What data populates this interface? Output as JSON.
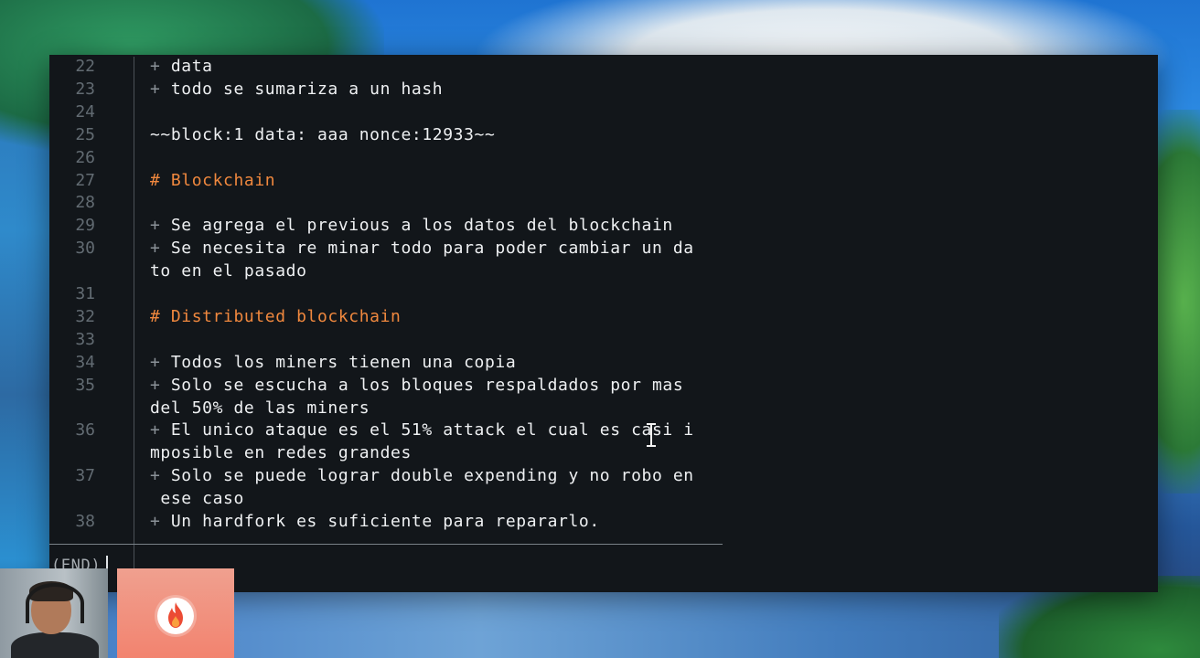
{
  "terminal": {
    "lines": [
      {
        "num": "22",
        "prefix": "+",
        "text": "data"
      },
      {
        "num": "23",
        "prefix": "+",
        "text": "todo se sumariza a un hash"
      },
      {
        "num": "24",
        "prefix": "",
        "text": ""
      },
      {
        "num": "25",
        "prefix": "",
        "text": "~~block:1 data: aaa nonce:12933~~"
      },
      {
        "num": "26",
        "prefix": "",
        "text": ""
      },
      {
        "num": "27",
        "prefix": "",
        "text": "# Blockchain"
      },
      {
        "num": "28",
        "prefix": "",
        "text": ""
      },
      {
        "num": "29",
        "prefix": "+",
        "text": "Se agrega el previous a los datos del blockchain"
      },
      {
        "num": "30",
        "prefix": "+",
        "text": "Se necesita re minar todo para poder cambiar un da"
      },
      {
        "num": "",
        "prefix": "",
        "text": "to en el pasado"
      },
      {
        "num": "31",
        "prefix": "",
        "text": ""
      },
      {
        "num": "32",
        "prefix": "",
        "text": "# Distributed blockchain"
      },
      {
        "num": "33",
        "prefix": "",
        "text": ""
      },
      {
        "num": "34",
        "prefix": "+",
        "text": "Todos los miners tienen una copia"
      },
      {
        "num": "35",
        "prefix": "+",
        "text": "Solo se escucha a los bloques respaldados por mas"
      },
      {
        "num": "",
        "prefix": "",
        "text": "del 50% de las miners"
      },
      {
        "num": "36",
        "prefix": "+",
        "text": "El unico ataque es el 51% attack el cual es casi i"
      },
      {
        "num": "",
        "prefix": "",
        "text": "mposible en redes grandes"
      },
      {
        "num": "37",
        "prefix": "+",
        "text": "Solo se puede lograr double expending y no robo en"
      },
      {
        "num": "",
        "prefix": "",
        "text": " ese caso"
      },
      {
        "num": "38",
        "prefix": "+",
        "text": "Un hardfork es suficiente para repararlo."
      }
    ],
    "end_marker": "(END)"
  },
  "colors": {
    "terminal_bg": "#12161a",
    "text": "#eef0f2",
    "line_number": "#626b72",
    "heading": "#f0883e"
  },
  "overlay": {
    "webcam": "presenter-webcam",
    "logo": "flame-logo"
  }
}
